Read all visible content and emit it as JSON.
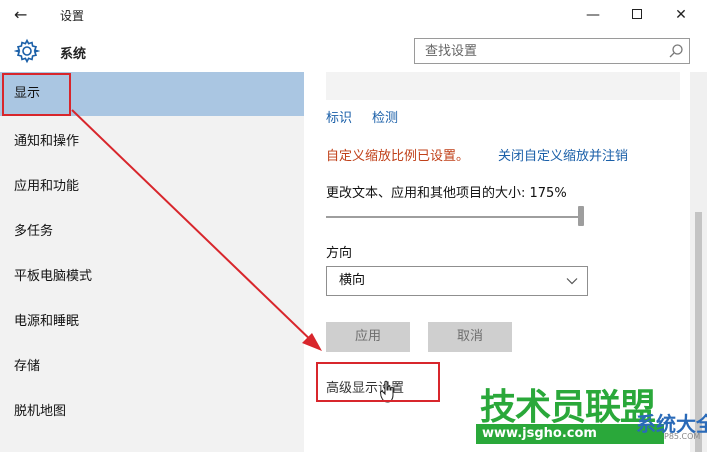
{
  "window": {
    "title": "设置",
    "back_glyph": "←",
    "minimize_glyph": "—",
    "close_glyph": "✕"
  },
  "header": {
    "section_title": "系统",
    "search_placeholder": "查找设置"
  },
  "sidebar": {
    "items": [
      {
        "label": "显示",
        "selected": true
      },
      {
        "label": "通知和操作"
      },
      {
        "label": "应用和功能"
      },
      {
        "label": "多任务"
      },
      {
        "label": "平板电脑模式"
      },
      {
        "label": "电源和睡眠"
      },
      {
        "label": "存储"
      },
      {
        "label": "脱机地图"
      }
    ]
  },
  "main": {
    "identify_link": "标识",
    "detect_link": "检测",
    "custom_scale_notice": "自定义缩放比例已设置。",
    "custom_scale_off_link": "关闭自定义缩放并注销",
    "size_label": "更改文本、应用和其他项目的大小: 175%",
    "size_slider_value": 1.0,
    "orientation_label": "方向",
    "orientation_value": "横向",
    "apply_button": "应用",
    "cancel_button": "取消",
    "advanced_link": "高级显示设置"
  },
  "watermark": {
    "main": "技术员联盟",
    "url": "www.jsgho.com",
    "side": "系统大全",
    "small": "P85.COM"
  },
  "colors": {
    "selection": "#aac6e2",
    "link": "#1a5fa8",
    "warning": "#c0411a",
    "annotation": "#d8262c",
    "watermark_green": "#2aa83a"
  }
}
